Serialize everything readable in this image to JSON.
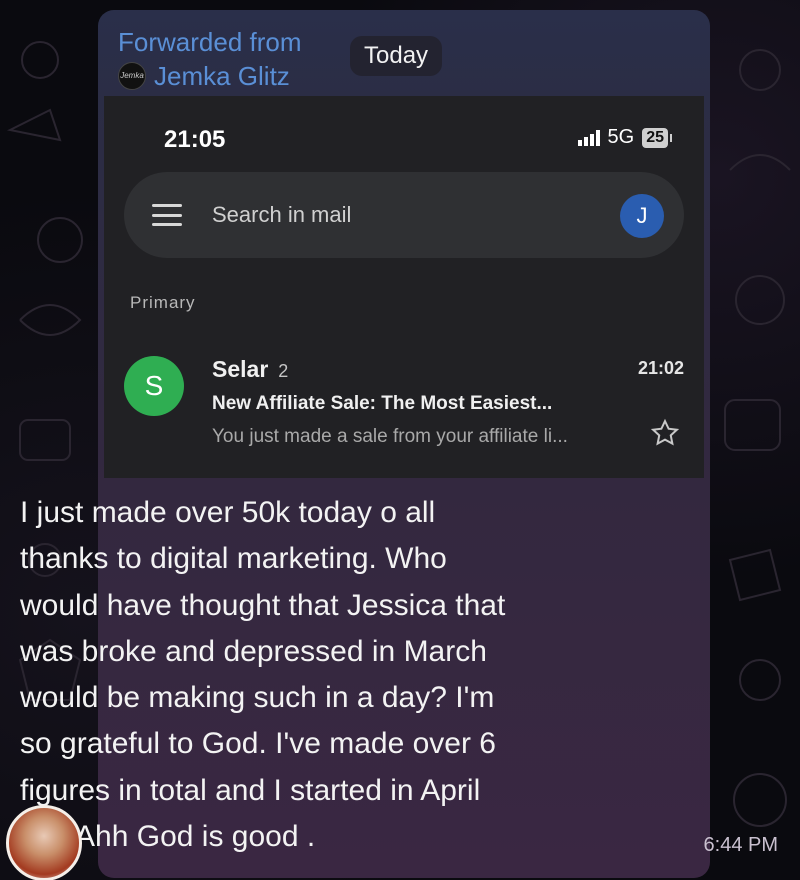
{
  "forward": {
    "label": "Forwarded from",
    "sender": "Jemka Glitz"
  },
  "date_pill": "Today",
  "screenshot": {
    "status_time": "21:05",
    "network": "5G",
    "battery": "25",
    "search_placeholder": "Search in mail",
    "account_initial": "J",
    "section": "Primary",
    "email": {
      "avatar_initial": "S",
      "sender": "Selar",
      "thread_count": "2",
      "time": "21:02",
      "subject": "New Affiliate Sale: The Most Easiest...",
      "snippet": "You just made a sale from your affiliate li..."
    }
  },
  "message": {
    "lines": [
      "I just made over 50k today o all",
      "thanks to digital marketing. Who",
      "would have thought that Jessica that",
      "was broke and depressed in March",
      "would be making such in a day? I'm",
      "so grateful to God. I've made over 6",
      "figures in total and I started in  April",
      "Oo. Ahh God is good ."
    ],
    "time": "6:44 PM"
  },
  "colors": {
    "forward_link": "#5a8fd6",
    "gmail_dark": "#212124",
    "sender_avatar": "#2fae52",
    "account_avatar": "#2a5db0"
  }
}
